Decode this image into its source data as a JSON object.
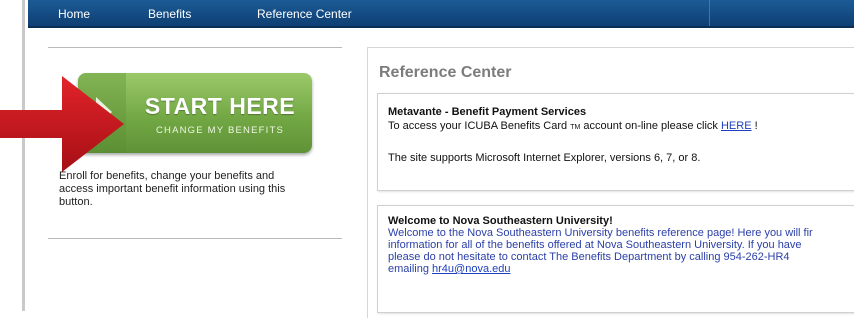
{
  "nav": {
    "items": [
      "Home",
      "Benefits",
      "Reference Center"
    ]
  },
  "start_button": {
    "title": "START HERE",
    "subtitle": "CHANGE MY BENEFITS"
  },
  "enroll_text": "Enroll for benefits, change your benefits and access important benefit information using this button.",
  "reference_center": {
    "title": "Reference Center",
    "metavante": {
      "heading": "Metavante - Benefit Payment Services",
      "line1_prefix": "To access your ICUBA Benefits Card",
      "tm": "TM",
      "line1_middle": "account on-line please click",
      "here_link": "HERE",
      "line1_suffix": "!",
      "line2": "The site supports Microsoft Internet Explorer, versions 6, 7, or 8."
    },
    "welcome": {
      "heading": "Welcome to Nova Southeastern University!",
      "line1": "Welcome to the Nova Southeastern University benefits reference page!  Here you will fir",
      "line2": "information for all of the benefits offered at Nova Southeastern University.  If you have",
      "line3": "please do not hesitate to contact The Benefits Department by calling 954-262-HR4",
      "line4_prefix": "emailing",
      "email_link": "hr4u@nova.edu"
    }
  },
  "colors": {
    "nav_bg": "#0e3f73",
    "button_green": "#73a845",
    "arrow_red": "#c8161d",
    "link_blue": "#1d3fc0",
    "title_gray": "#7c7c7c"
  }
}
